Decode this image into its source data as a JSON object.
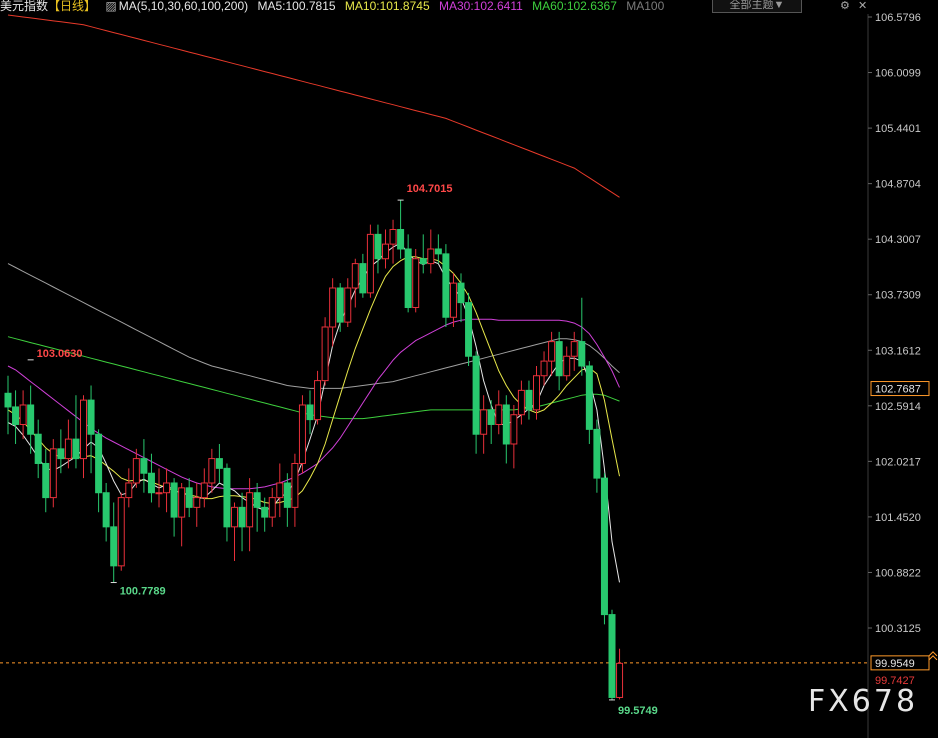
{
  "header": {
    "symbol": "美元指数",
    "period": "【日线】",
    "ma_params": "MA(5,10,30,60,100,200)",
    "ma5": "MA5:100.7815",
    "ma10": "MA10:101.8745",
    "ma30": "MA30:102.6411",
    "ma60": "MA60:102.6367",
    "ma100": "MA100",
    "theme_label": "全部主题▼"
  },
  "colors": {
    "up": "#e8303a",
    "down": "#28c86e",
    "ma5": "#e6e6e6",
    "ma10": "#e8e84a",
    "ma30": "#d040d8",
    "ma60": "#3ed03e",
    "ma100": "#a0a0a0",
    "ma200": "#e83a2a",
    "high_label": "#ff4848",
    "low_label": "#5ad88a",
    "price_line": "#ff9a2a"
  },
  "chart_data": {
    "type": "candlestick",
    "y_ticks": [
      "106.5796",
      "106.0099",
      "105.4401",
      "104.8704",
      "104.3007",
      "103.7309",
      "103.1612",
      "102.5914",
      "102.0217",
      "101.4520",
      "100.8822",
      "100.3125"
    ],
    "ylim": [
      99.5,
      106.6
    ],
    "current_price": "99.9549",
    "crosshair_value": "102.7687",
    "low_value_tag": "99.7427",
    "annotations": {
      "high": "104.7015",
      "left_high": "103.0630",
      "left_low": "100.7789",
      "low": "99.5749"
    },
    "candles": [
      [
        102.72,
        102.58,
        102.9,
        102.3
      ],
      [
        102.58,
        102.4,
        102.75,
        102.2
      ],
      [
        102.4,
        102.6,
        102.75,
        102.25
      ],
      [
        102.6,
        102.3,
        102.8,
        102.1
      ],
      [
        102.3,
        102.0,
        102.45,
        101.85
      ],
      [
        102.0,
        101.65,
        102.15,
        101.5
      ],
      [
        101.65,
        102.15,
        102.25,
        101.55
      ],
      [
        102.15,
        102.05,
        102.35,
        101.9
      ],
      [
        102.05,
        102.25,
        102.45,
        101.95
      ],
      [
        102.25,
        102.05,
        102.7,
        101.95
      ],
      [
        102.05,
        102.65,
        102.7,
        101.85
      ],
      [
        102.65,
        102.3,
        102.8,
        101.9
      ],
      [
        102.3,
        101.7,
        102.35,
        101.5
      ],
      [
        101.7,
        101.35,
        101.8,
        101.2
      ],
      [
        101.35,
        100.95,
        101.6,
        100.78
      ],
      [
        100.95,
        101.65,
        101.7,
        100.9
      ],
      [
        101.65,
        101.8,
        101.95,
        101.55
      ],
      [
        101.8,
        102.05,
        102.15,
        101.75
      ],
      [
        102.05,
        101.9,
        102.25,
        101.7
      ],
      [
        101.9,
        101.7,
        102.1,
        101.6
      ],
      [
        101.7,
        101.7,
        101.95,
        101.55
      ],
      [
        101.7,
        101.8,
        101.95,
        101.5
      ],
      [
        101.8,
        101.45,
        101.85,
        101.25
      ],
      [
        101.45,
        101.75,
        101.8,
        101.15
      ],
      [
        101.75,
        101.55,
        101.85,
        101.45
      ],
      [
        101.55,
        101.65,
        101.8,
        101.35
      ],
      [
        101.65,
        101.8,
        101.95,
        101.55
      ],
      [
        101.8,
        102.05,
        102.15,
        101.7
      ],
      [
        102.05,
        101.95,
        102.2,
        101.8
      ],
      [
        101.95,
        101.35,
        102.0,
        101.2
      ],
      [
        101.35,
        101.55,
        101.6,
        101.0
      ],
      [
        101.55,
        101.35,
        101.7,
        101.1
      ],
      [
        101.35,
        101.7,
        101.85,
        101.1
      ],
      [
        101.7,
        101.55,
        101.8,
        101.3
      ],
      [
        101.55,
        101.45,
        101.65,
        101.3
      ],
      [
        101.45,
        101.65,
        101.75,
        101.35
      ],
      [
        101.65,
        101.8,
        102.0,
        101.45
      ],
      [
        101.8,
        101.55,
        101.9,
        101.35
      ],
      [
        101.55,
        102.0,
        102.1,
        101.35
      ],
      [
        102.0,
        102.6,
        102.7,
        101.9
      ],
      [
        102.6,
        102.45,
        102.75,
        102.3
      ],
      [
        102.45,
        102.85,
        102.95,
        102.4
      ],
      [
        102.85,
        103.4,
        103.5,
        102.8
      ],
      [
        103.4,
        103.8,
        103.9,
        103.2
      ],
      [
        103.8,
        103.45,
        103.85,
        103.35
      ],
      [
        103.45,
        103.8,
        103.9,
        103.4
      ],
      [
        103.8,
        104.05,
        104.1,
        103.6
      ],
      [
        104.05,
        103.75,
        104.15,
        103.7
      ],
      [
        103.75,
        104.35,
        104.45,
        103.7
      ],
      [
        104.35,
        104.1,
        104.45,
        103.95
      ],
      [
        104.1,
        104.25,
        104.4,
        104.0
      ],
      [
        104.25,
        104.4,
        104.5,
        104.05
      ],
      [
        104.4,
        104.2,
        104.7,
        104.1
      ],
      [
        104.2,
        103.6,
        104.35,
        103.55
      ],
      [
        103.6,
        104.1,
        104.2,
        103.55
      ],
      [
        104.1,
        104.05,
        104.35,
        103.95
      ],
      [
        104.05,
        104.2,
        104.4,
        103.95
      ],
      [
        104.2,
        104.15,
        104.35,
        104.05
      ],
      [
        104.15,
        103.5,
        104.25,
        103.4
      ],
      [
        103.5,
        103.85,
        103.95,
        103.4
      ],
      [
        103.85,
        103.65,
        103.95,
        103.45
      ],
      [
        103.65,
        103.1,
        103.75,
        103.0
      ],
      [
        103.1,
        102.3,
        103.15,
        102.1
      ],
      [
        102.3,
        102.55,
        102.7,
        102.1
      ],
      [
        102.55,
        102.4,
        102.65,
        102.2
      ],
      [
        102.4,
        102.6,
        102.75,
        102.3
      ],
      [
        102.6,
        102.2,
        102.7,
        102.0
      ],
      [
        102.2,
        102.5,
        102.6,
        101.95
      ],
      [
        102.5,
        102.75,
        102.85,
        102.4
      ],
      [
        102.75,
        102.55,
        102.85,
        102.45
      ],
      [
        102.55,
        102.9,
        103.0,
        102.45
      ],
      [
        102.9,
        103.05,
        103.15,
        102.8
      ],
      [
        103.05,
        103.25,
        103.35,
        102.9
      ],
      [
        103.25,
        102.9,
        103.35,
        102.75
      ],
      [
        102.9,
        103.1,
        103.2,
        102.85
      ],
      [
        103.1,
        103.25,
        103.35,
        102.95
      ],
      [
        103.25,
        103.0,
        103.7,
        102.9
      ],
      [
        103.0,
        102.35,
        103.05,
        102.2
      ],
      [
        102.35,
        101.85,
        102.45,
        101.7
      ],
      [
        101.85,
        100.45,
        101.9,
        100.35
      ],
      [
        100.45,
        99.6,
        100.5,
        99.57
      ],
      [
        99.6,
        99.95,
        100.1,
        99.58
      ]
    ],
    "ma": {
      "ma5": [
        102.42,
        102.38,
        102.29,
        102.18,
        102.06,
        101.95,
        101.93,
        101.97,
        102.02,
        102.07,
        102.15,
        102.22,
        102.16,
        102.0,
        101.82,
        101.68,
        101.7,
        101.8,
        101.84,
        101.79,
        101.75,
        101.78,
        101.72,
        101.7,
        101.67,
        101.64,
        101.65,
        101.72,
        101.8,
        101.76,
        101.72,
        101.65,
        101.6,
        101.55,
        101.52,
        101.55,
        101.65,
        101.7,
        101.82,
        102.02,
        102.25,
        102.49,
        102.85,
        103.21,
        103.45,
        103.61,
        103.78,
        103.9,
        104.02,
        104.08,
        104.16,
        104.22,
        104.26,
        104.15,
        104.08,
        104.04,
        104.08,
        104.05,
        103.9,
        103.8,
        103.7,
        103.5,
        103.2,
        102.85,
        102.6,
        102.4,
        102.4,
        102.44,
        102.5,
        102.56,
        102.62,
        102.8,
        102.92,
        103.03,
        103.08,
        103.08,
        103.05,
        102.85,
        102.55,
        101.95,
        101.2,
        100.78
      ],
      "ma10": [
        102.55,
        102.5,
        102.43,
        102.34,
        102.25,
        102.16,
        102.1,
        102.06,
        102.05,
        102.06,
        102.07,
        102.08,
        102.04,
        101.98,
        101.92,
        101.85,
        101.82,
        101.83,
        101.83,
        101.81,
        101.78,
        101.75,
        101.72,
        101.7,
        101.68,
        101.66,
        101.64,
        101.64,
        101.66,
        101.67,
        101.67,
        101.66,
        101.65,
        101.63,
        101.6,
        101.59,
        101.6,
        101.62,
        101.65,
        101.72,
        101.85,
        102.0,
        102.2,
        102.45,
        102.7,
        102.95,
        103.18,
        103.38,
        103.58,
        103.76,
        103.92,
        104.02,
        104.08,
        104.12,
        104.12,
        104.1,
        104.1,
        104.08,
        104.02,
        103.95,
        103.85,
        103.72,
        103.55,
        103.35,
        103.15,
        102.95,
        102.8,
        102.68,
        102.6,
        102.55,
        102.52,
        102.55,
        102.62,
        102.7,
        102.8,
        102.88,
        102.96,
        102.98,
        102.92,
        102.65,
        102.25,
        101.87
      ],
      "ma30": [
        103.0,
        102.96,
        102.9,
        102.84,
        102.78,
        102.72,
        102.66,
        102.6,
        102.54,
        102.48,
        102.42,
        102.36,
        102.31,
        102.26,
        102.22,
        102.18,
        102.14,
        102.1,
        102.06,
        102.02,
        101.98,
        101.94,
        101.9,
        101.86,
        101.83,
        101.8,
        101.78,
        101.76,
        101.75,
        101.74,
        101.74,
        101.74,
        101.74,
        101.75,
        101.76,
        101.78,
        101.8,
        101.83,
        101.86,
        101.9,
        101.95,
        102.0,
        102.08,
        102.16,
        102.26,
        102.38,
        102.5,
        102.62,
        102.74,
        102.86,
        102.96,
        103.06,
        103.14,
        103.2,
        103.26,
        103.3,
        103.34,
        103.38,
        103.42,
        103.45,
        103.47,
        103.48,
        103.48,
        103.48,
        103.48,
        103.47,
        103.47,
        103.47,
        103.47,
        103.47,
        103.47,
        103.47,
        103.47,
        103.47,
        103.46,
        103.44,
        103.4,
        103.33,
        103.22,
        103.09,
        102.95,
        102.78
      ],
      "ma60": [
        103.3,
        103.28,
        103.26,
        103.24,
        103.22,
        103.2,
        103.18,
        103.16,
        103.14,
        103.12,
        103.1,
        103.08,
        103.06,
        103.04,
        103.02,
        103.0,
        102.98,
        102.96,
        102.94,
        102.92,
        102.9,
        102.88,
        102.86,
        102.84,
        102.82,
        102.8,
        102.78,
        102.76,
        102.74,
        102.72,
        102.7,
        102.68,
        102.66,
        102.64,
        102.62,
        102.6,
        102.58,
        102.56,
        102.54,
        102.52,
        102.5,
        102.49,
        102.48,
        102.47,
        102.46,
        102.46,
        102.46,
        102.46,
        102.47,
        102.48,
        102.49,
        102.5,
        102.51,
        102.52,
        102.53,
        102.54,
        102.55,
        102.55,
        102.55,
        102.55,
        102.55,
        102.55,
        102.55,
        102.55,
        102.55,
        102.55,
        102.55,
        102.55,
        102.56,
        102.57,
        102.58,
        102.6,
        102.62,
        102.64,
        102.66,
        102.68,
        102.7,
        102.71,
        102.71,
        102.7,
        102.67,
        102.64
      ],
      "ma100": [
        104.05,
        104.01,
        103.97,
        103.93,
        103.89,
        103.85,
        103.81,
        103.77,
        103.73,
        103.69,
        103.65,
        103.61,
        103.57,
        103.53,
        103.49,
        103.45,
        103.41,
        103.37,
        103.33,
        103.29,
        103.25,
        103.21,
        103.17,
        103.13,
        103.09,
        103.06,
        103.03,
        103.0,
        102.98,
        102.96,
        102.94,
        102.92,
        102.9,
        102.88,
        102.86,
        102.84,
        102.82,
        102.8,
        102.79,
        102.78,
        102.77,
        102.77,
        102.77,
        102.77,
        102.77,
        102.78,
        102.79,
        102.8,
        102.81,
        102.82,
        102.83,
        102.84,
        102.86,
        102.88,
        102.9,
        102.92,
        102.94,
        102.96,
        102.98,
        103.0,
        103.02,
        103.04,
        103.06,
        103.08,
        103.1,
        103.12,
        103.14,
        103.16,
        103.18,
        103.2,
        103.22,
        103.24,
        103.26,
        103.28,
        103.28,
        103.27,
        103.25,
        103.21,
        103.15,
        103.08,
        103.0,
        102.93
      ],
      "ma200": [
        106.6,
        106.59,
        106.58,
        106.57,
        106.56,
        106.55,
        106.54,
        106.53,
        106.52,
        106.51,
        106.5,
        106.48,
        106.46,
        106.44,
        106.42,
        106.4,
        106.38,
        106.36,
        106.34,
        106.32,
        106.3,
        106.28,
        106.26,
        106.24,
        106.22,
        106.2,
        106.18,
        106.16,
        106.14,
        106.12,
        106.1,
        106.08,
        106.06,
        106.04,
        106.02,
        106.0,
        105.98,
        105.96,
        105.94,
        105.92,
        105.9,
        105.88,
        105.86,
        105.84,
        105.82,
        105.8,
        105.78,
        105.76,
        105.74,
        105.72,
        105.7,
        105.68,
        105.66,
        105.64,
        105.62,
        105.6,
        105.58,
        105.56,
        105.54,
        105.51,
        105.48,
        105.45,
        105.42,
        105.39,
        105.36,
        105.33,
        105.3,
        105.27,
        105.24,
        105.21,
        105.18,
        105.15,
        105.12,
        105.09,
        105.06,
        105.03,
        104.98,
        104.93,
        104.88,
        104.83,
        104.78,
        104.73
      ]
    }
  },
  "watermark": "FX678"
}
